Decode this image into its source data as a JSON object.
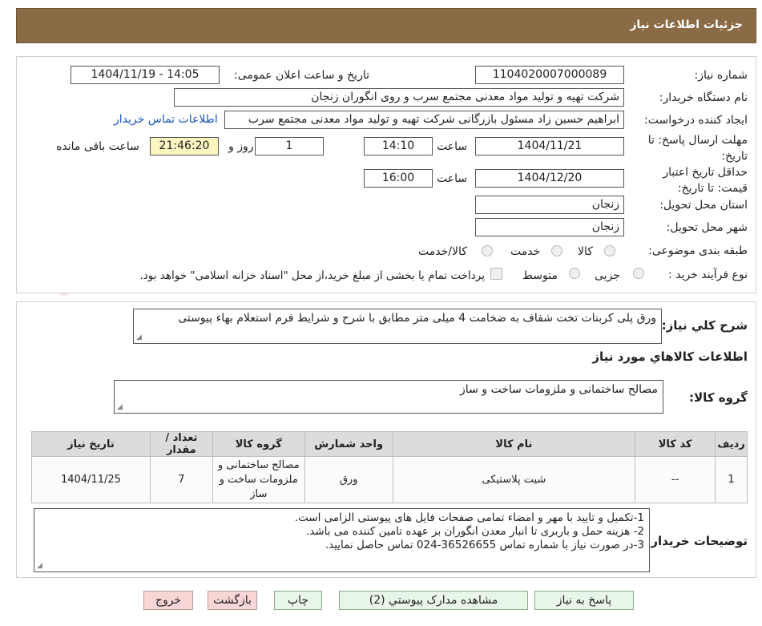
{
  "header": {
    "title": "جزئیات اطلاعات نیاز"
  },
  "form": {
    "need_number_label": "شماره نیاز:",
    "need_number": "1104020007000089",
    "announce_label": "تاریخ و ساعت اعلان عمومی:",
    "announce_value": "1404/11/19 - 14:05",
    "buyer_label": "نام دستگاه خریدار:",
    "buyer_value": "شرکت تهیه و تولید مواد معدنی مجتمع سرب و روی انگوران   زنجان",
    "creator_label": "ایجاد کننده درخواست:",
    "creator_value": "ابراهیم حسین زاد مسئول بازرگانی شرکت تهیه و تولید مواد معدنی مجتمع سرب",
    "contact_link": "اطلاعات تماس خریدار",
    "reply_deadline_label": "مهلت ارسال پاسخ: تا تاریخ:",
    "reply_date": "1404/11/21",
    "time_label": "ساعت",
    "reply_time": "14:10",
    "days_value": "1",
    "days_label": "روز و",
    "remaining_value": "21:46:20",
    "remaining_label": "ساعت باقی مانده",
    "validity_label": "حداقل تاریخ اعتبار قیمت: تا تاریخ:",
    "validity_date": "1404/12/20",
    "validity_time": "16:00",
    "province_label": "استان محل تحویل:",
    "province_value": "زنجان",
    "city_label": "شهر محل تحویل:",
    "city_value": "زنجان",
    "category_label": "طبقه بندی موضوعی:",
    "category_options": [
      "کالا",
      "خدمت",
      "کالا/خدمت"
    ],
    "process_label": "نوع فرآیند خرید :",
    "process_options": [
      "جزیی",
      "متوسط"
    ],
    "payment_note": "پرداخت تمام یا بخشی از مبلغ خرید،از محل \"اسناد خزانه اسلامی\" خواهد بود."
  },
  "details": {
    "summary_label": "شرح کلي نياز:",
    "summary_value": "ورق پلی کربنات تخت شفاف به ضخامت 4 میلی متر مطابق با شرح و شرایط فرم استعلام بهاء پیوستی",
    "goods_info_title": "اطلاعات کالاهاي مورد نياز",
    "goods_group_label": "گروه کالا:",
    "goods_group_value": "مصالح ساختمانی و ملزومات ساخت و ساز",
    "table": {
      "headers": [
        "ردیف",
        "کد کالا",
        "نام کالا",
        "واحد شمارش",
        "گروه کالا",
        "تعداد / مقدار",
        "تاریخ نیاز"
      ],
      "rows": [
        [
          "1",
          "--",
          "شیت پلاستیکی",
          "ورق",
          "مصالح ساختمانی و ملزومات ساخت و ساز",
          "7",
          "1404/11/25"
        ]
      ]
    },
    "buyer_notes_label": "توضیحات خریدار:",
    "buyer_notes": "1-تکمیل و تایید با مهر و امضاء تمامی صفحات فایل های پیوستی الزامی است.\n2- هزینه حمل و باربری تا انبار معدن انگوران بر عهده تامین کننده می باشد.\n3-در صورت نیاز با شماره تماس 36526655-024 تماس حاصل نمایید."
  },
  "buttons": {
    "reply": "پاسخ به نیاز",
    "attachments": "مشاهده مدارک پیوستي (2)",
    "print": "چاپ",
    "back": "بازگشت",
    "exit": "خروج"
  },
  "watermark_text": "AriaTender.neT",
  "colors": {
    "header": "#8b6b46",
    "highlight": "#fbf5c0",
    "link": "#1a56c4"
  }
}
